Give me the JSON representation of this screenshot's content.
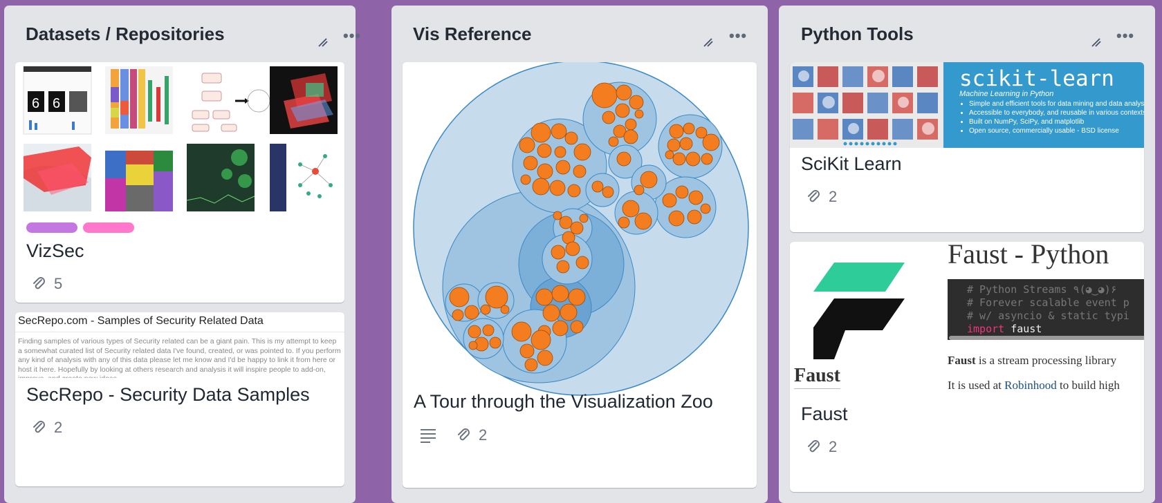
{
  "lists": [
    {
      "title": "Datasets / Repositories",
      "cards": [
        {
          "title": "VizSec",
          "attachments": "5",
          "labels": [
            "#c377e0",
            "#ff78cb"
          ]
        },
        {
          "title": "SecRepo - Security Data Samples",
          "attachments": "2",
          "cover_heading": "SecRepo.com - Samples of Security Related Data",
          "cover_text": "Finding samples of various types of Security related can be a giant pain. This is my attempt to keep a somewhat curated list of Security related data I've found, created, or was pointed to. If you perform any kind of analysis with any of this data please let me know and I'd be happy to link it from here or host it here. Hopefully by looking at others research and analysis it will inspire people to add-on, improve, and create new ideas."
        }
      ]
    },
    {
      "title": "Vis Reference",
      "cards": [
        {
          "title": "A Tour through the Visualization Zoo",
          "attachments": "2"
        }
      ]
    },
    {
      "title": "Python Tools",
      "cards": [
        {
          "title": "SciKit Learn",
          "attachments": "2",
          "cover_brand": "scikit-learn",
          "cover_subtitle": "Machine Learning in Python",
          "cover_bullets": [
            "Simple and efficient tools for data mining and data analysis",
            "Accessible to everybody, and reusable in various contexts",
            "Built on NumPy, SciPy, and matplotlib",
            "Open source, commercially usable - BSD license"
          ]
        },
        {
          "title": "Faust",
          "attachments": "2",
          "cover_heading": "Faust - Python",
          "cover_logo_text": "Faust",
          "code_lines": [
            "# Python Streams ٩(◕‿◕)۶",
            "# Forever scalable event p",
            "# w/ asyncio & static typi"
          ],
          "code_import_keyword": "import",
          "code_import_name": "faust",
          "desc_bold": "Faust",
          "desc_rest": " is a stream processing library",
          "desc2_pre": "It is used at ",
          "desc2_link": "Robinhood",
          "desc2_post": " to build high"
        }
      ]
    }
  ]
}
